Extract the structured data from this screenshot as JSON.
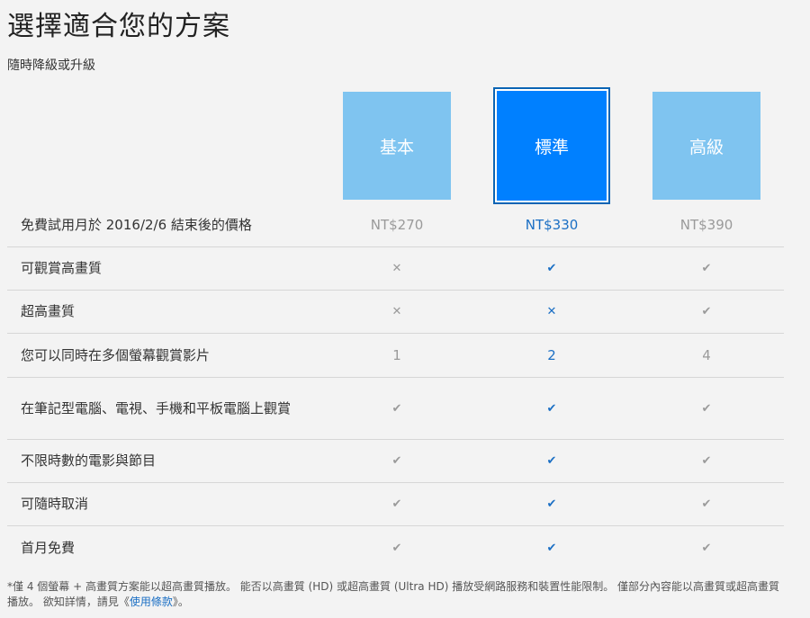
{
  "header": {
    "title": "選擇適合您的方案",
    "subtitle": "隨時降級或升級"
  },
  "plans": [
    {
      "name": "基本",
      "selected": false
    },
    {
      "name": "標準",
      "selected": true
    },
    {
      "name": "高級",
      "selected": false
    }
  ],
  "rows": [
    {
      "label": "免費試用月於 2016/2/6 結束後的價格",
      "values": [
        "NT$270",
        "NT$330",
        "NT$390"
      ]
    },
    {
      "label": "可觀賞高畫質",
      "values": [
        "✕",
        "✔",
        "✔"
      ],
      "icons": [
        "cross-icon",
        "check-icon",
        "check-icon"
      ]
    },
    {
      "label": "超高畫質",
      "values": [
        "✕",
        "✕",
        "✔"
      ],
      "icons": [
        "cross-icon",
        "cross-icon",
        "check-icon"
      ]
    },
    {
      "label": "您可以同時在多個螢幕觀賞影片",
      "values": [
        "1",
        "2",
        "4"
      ]
    },
    {
      "label": "在筆記型電腦、電視、手機和平板電腦上觀賞",
      "values": [
        "✔",
        "✔",
        "✔"
      ],
      "icons": [
        "check-icon",
        "check-icon",
        "check-icon"
      ]
    },
    {
      "label": "不限時數的電影與節目",
      "values": [
        "✔",
        "✔",
        "✔"
      ],
      "icons": [
        "check-icon",
        "check-icon",
        "check-icon"
      ]
    },
    {
      "label": "可隨時取消",
      "values": [
        "✔",
        "✔",
        "✔"
      ],
      "icons": [
        "check-icon",
        "check-icon",
        "check-icon"
      ]
    },
    {
      "label": "首月免費",
      "values": [
        "✔",
        "✔",
        "✔"
      ],
      "icons": [
        "check-icon",
        "check-icon",
        "check-icon"
      ]
    }
  ],
  "footnote": {
    "text_before": "*僅 4 個螢幕 + 高畫質方案能以超高畫質播放。 能否以高畫質 (HD) 或超高畫質 (Ultra HD) 播放受網路服務和裝置性能限制。 僅部分內容能以高畫質或超高畫質播放。 欲知詳情，請見《",
    "link": "使用條款",
    "text_after": "》。"
  },
  "colors": {
    "plan_unselected": "#7fc4f0",
    "plan_selected": "#0080ff",
    "highlight_text": "#1b6fc4",
    "muted_text": "#9a9a9a"
  }
}
